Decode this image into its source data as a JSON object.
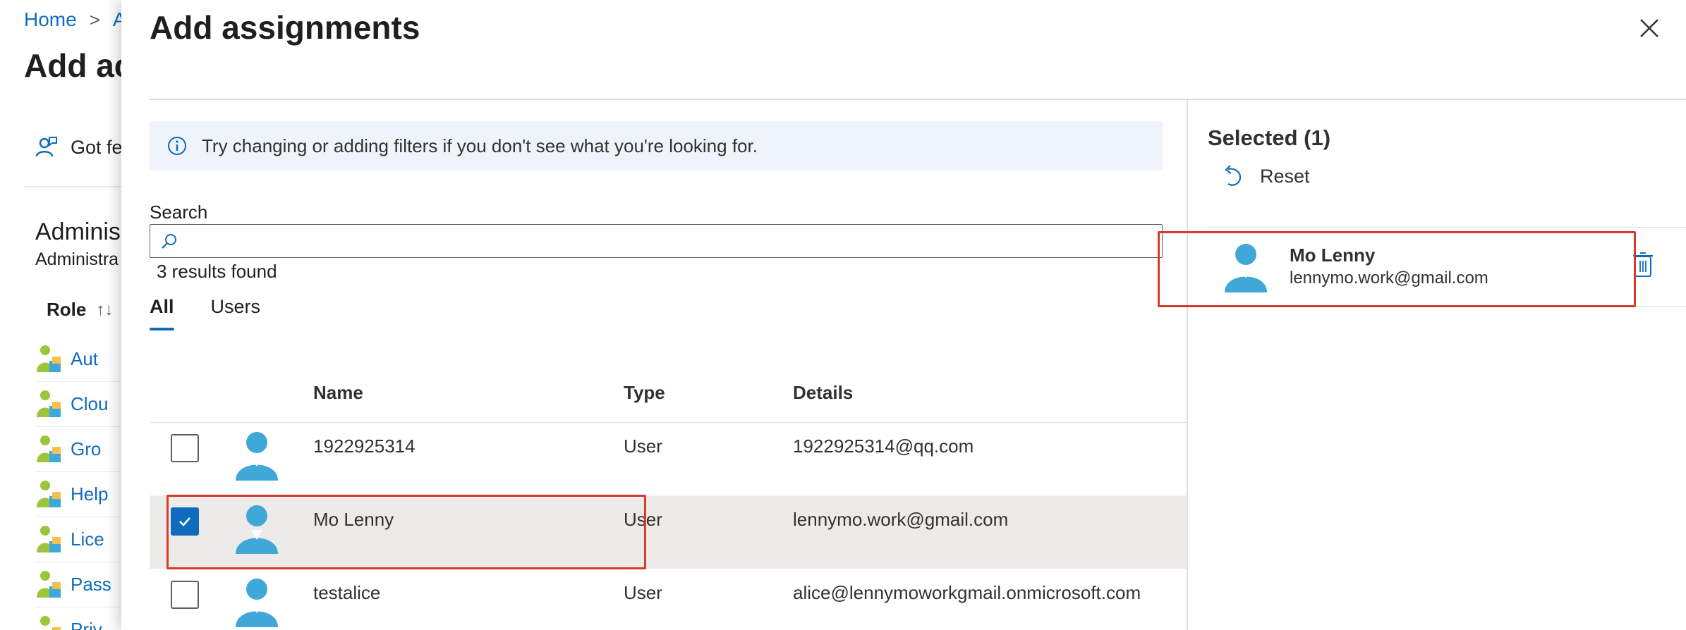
{
  "background": {
    "breadcrumb": [
      "Home",
      "A"
    ],
    "title": "Add ac",
    "feedback_label": "Got fe",
    "section_title": "Adminis",
    "section_subtitle": "Administra",
    "role_header": "Role",
    "role_sort": "↑↓",
    "roles": [
      "Aut",
      "Clou",
      "Gro",
      "Help",
      "Lice",
      "Pass",
      "Priv"
    ]
  },
  "panel": {
    "title": "Add assignments",
    "info_message": "Try changing or adding filters if you don't see what you're looking for.",
    "search": {
      "label": "Search",
      "value": "",
      "placeholder": ""
    },
    "results_count": "3 results found",
    "tabs": [
      {
        "label": "All",
        "active": true
      },
      {
        "label": "Users",
        "active": false
      }
    ],
    "columns": {
      "name": "Name",
      "type": "Type",
      "details": "Details"
    },
    "rows": [
      {
        "name": "1922925314",
        "type": "User",
        "details": "1922925314@qq.com",
        "checked": false
      },
      {
        "name": "Mo Lenny",
        "type": "User",
        "details": "lennymo.work@gmail.com",
        "checked": true
      },
      {
        "name": "testalice",
        "type": "User",
        "details": "alice@lennymoworkgmail.onmicrosoft.com",
        "checked": false
      }
    ],
    "selected": {
      "title": "Selected (1)",
      "reset_label": "Reset",
      "items": [
        {
          "name": "Mo Lenny",
          "email": "lennymo.work@gmail.com"
        }
      ]
    }
  },
  "colors": {
    "accent": "#0f6cbd",
    "highlight": "#d9392b",
    "selected_row": "#edebe9",
    "info_bg": "#eff4fb"
  }
}
